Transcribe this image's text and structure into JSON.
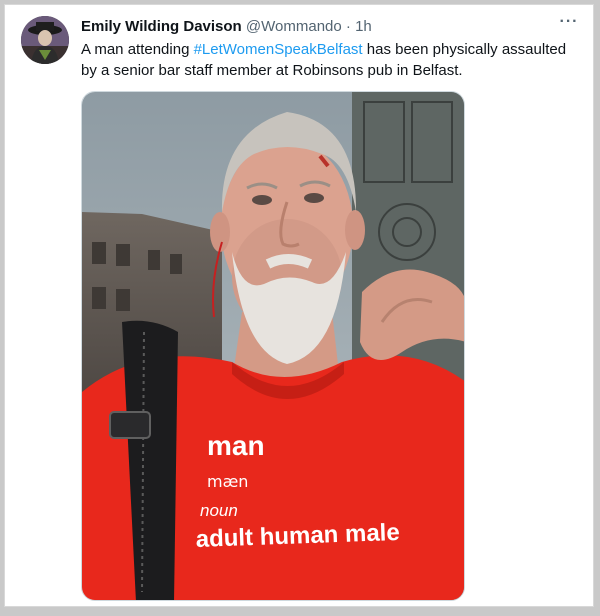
{
  "tweet": {
    "author_name": "Emily Wilding Davison",
    "author_handle": "@Wommando",
    "separator": "·",
    "time": "1h",
    "more_label": "···",
    "text_before": "A man attending ",
    "hashtag": "#LetWomenSpeakBelfast",
    "text_after": " has been physically assaulted by a senior bar staff member at Robinsons pub in Belfast."
  },
  "media": {
    "shirt_word": "man",
    "shirt_pronunciation": "mæn",
    "shirt_pos": "noun",
    "shirt_definition": "adult human male"
  },
  "colors": {
    "hashtag": "#1d9bf0",
    "name": "#0f1419",
    "muted": "#536471",
    "shirt": "#e8281c"
  }
}
